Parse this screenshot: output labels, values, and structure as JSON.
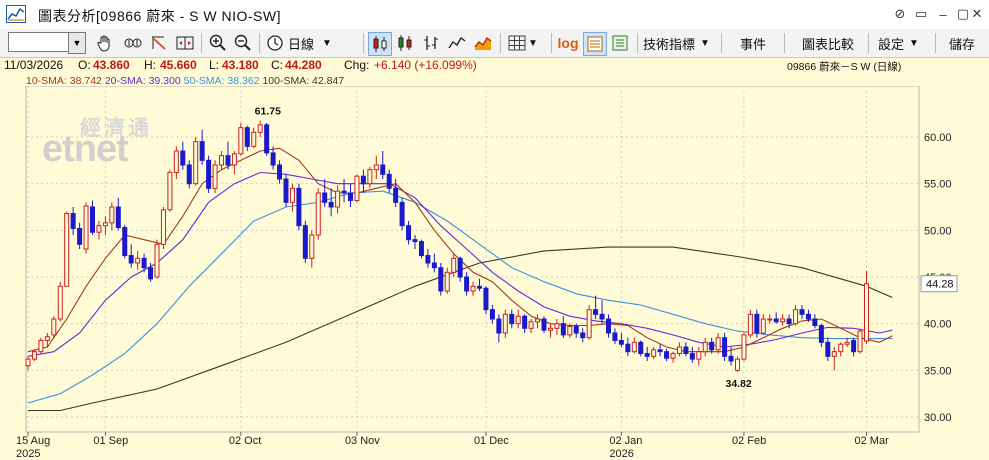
{
  "window": {
    "title": "圖表分析[09866 蔚來 - S W NIO-SW]",
    "buttons": [
      "⊘",
      "▭",
      "–",
      "▢",
      "✕"
    ]
  },
  "toolbar": {
    "code_value": "",
    "interval_label": "日線",
    "indicators_label": "技術指標",
    "events_label": "事件",
    "compare_label": "圖表比較",
    "settings_label": "設定",
    "save_label": "儲存",
    "log_label": "log"
  },
  "info": {
    "date": "11/03/2026",
    "open_label": "O:",
    "open": "43.860",
    "high_label": "H:",
    "high": "45.660",
    "low_label": "L:",
    "low": "43.180",
    "close_label": "C:",
    "close": "44.280",
    "chg_label": "Chg:",
    "chg": "+6.140 (+16.099%)",
    "symbol": "09866 蔚來－S W (日線)"
  },
  "sma": {
    "sma10": "10-SMA: 38.742",
    "sma20": "20-SMA: 39.300",
    "sma50": "50-SMA: 38.362",
    "sma100": "100-SMA: 42.847"
  },
  "watermark": {
    "cn": "經濟通",
    "en": "etnet"
  },
  "colors": {
    "up": "#cc2222",
    "down": "#1a1acc",
    "sma10": "#a03a1a",
    "sma20": "#6a2ad8",
    "sma50": "#3f8fe0",
    "sma100": "#3a3a22",
    "bg": "#fffbd6",
    "grid": "#cfcfcf",
    "last_label_bg": "#ffffff"
  },
  "chart_data": {
    "type": "candlestick",
    "y_axis": {
      "min": 28,
      "max": 63,
      "ticks": [
        "30.00",
        "35.00",
        "40.00",
        "45.00",
        "50.00",
        "55.00",
        "60.00"
      ],
      "last_value": "44.28"
    },
    "x_axis": {
      "labels": [
        {
          "text": "15 Aug",
          "sub": "2025",
          "i": 0
        },
        {
          "text": "01 Sep",
          "sub": "",
          "i": 12
        },
        {
          "text": "02 Oct",
          "sub": "",
          "i": 33
        },
        {
          "text": "03 Nov",
          "sub": "",
          "i": 51
        },
        {
          "text": "01 Dec",
          "sub": "",
          "i": 71
        },
        {
          "text": "02 Jan",
          "sub": "2026",
          "i": 92
        },
        {
          "text": "02 Feb",
          "sub": "",
          "i": 111
        },
        {
          "text": "02 Mar",
          "sub": "",
          "i": 130
        }
      ]
    },
    "annotations": [
      {
        "text": "61.75",
        "i": 37,
        "price": 61.75,
        "pos": "above"
      },
      {
        "text": "34.82",
        "i": 110,
        "price": 34.82,
        "pos": "below"
      }
    ],
    "ohlc": [
      [
        35.5,
        36.5,
        35.0,
        36.2
      ],
      [
        36.2,
        37.2,
        36.0,
        37.0
      ],
      [
        37.0,
        38.5,
        36.8,
        38.2
      ],
      [
        38.2,
        39.0,
        37.5,
        38.6
      ],
      [
        38.8,
        40.8,
        38.5,
        40.5
      ],
      [
        40.5,
        44.5,
        40.2,
        44.0
      ],
      [
        44.0,
        52.0,
        44.0,
        51.8
      ],
      [
        51.8,
        52.5,
        49.5,
        50.2
      ],
      [
        50.2,
        50.8,
        48.0,
        48.5
      ],
      [
        48.0,
        53.0,
        47.5,
        52.6
      ],
      [
        52.5,
        53.2,
        49.5,
        49.8
      ],
      [
        49.8,
        51.0,
        49.0,
        50.5
      ],
      [
        50.5,
        51.5,
        49.5,
        50.8
      ],
      [
        50.8,
        53.0,
        50.0,
        52.5
      ],
      [
        52.5,
        53.5,
        50.0,
        50.3
      ],
      [
        50.3,
        50.6,
        47.0,
        47.3
      ],
      [
        47.3,
        48.5,
        46.0,
        46.5
      ],
      [
        46.5,
        47.8,
        45.8,
        47.0
      ],
      [
        47.0,
        47.5,
        45.5,
        46.0
      ],
      [
        46.0,
        46.5,
        44.5,
        44.8
      ],
      [
        45.0,
        49.0,
        44.8,
        48.5
      ],
      [
        48.5,
        52.5,
        48.0,
        52.2
      ],
      [
        52.2,
        56.5,
        52.0,
        56.2
      ],
      [
        56.2,
        59.0,
        55.5,
        58.5
      ],
      [
        58.5,
        59.5,
        56.5,
        57.0
      ],
      [
        57.0,
        57.5,
        54.5,
        55.0
      ],
      [
        55.0,
        60.0,
        54.8,
        59.5
      ],
      [
        59.5,
        60.8,
        57.0,
        57.5
      ],
      [
        57.5,
        58.0,
        54.0,
        54.5
      ],
      [
        54.5,
        57.5,
        54.0,
        57.0
      ],
      [
        57.0,
        58.5,
        56.5,
        58.0
      ],
      [
        58.0,
        59.5,
        56.5,
        57.0
      ],
      [
        57.0,
        58.5,
        56.0,
        58.2
      ],
      [
        58.2,
        61.5,
        58.0,
        61.0
      ],
      [
        61.0,
        61.2,
        58.5,
        59.0
      ],
      [
        59.0,
        61.0,
        58.8,
        60.5
      ],
      [
        60.5,
        61.75,
        60.0,
        61.3
      ],
      [
        61.3,
        61.5,
        58.0,
        58.3
      ],
      [
        58.3,
        59.0,
        56.5,
        57.0
      ],
      [
        57.0,
        57.5,
        55.0,
        55.5
      ],
      [
        55.5,
        56.0,
        52.5,
        53.0
      ],
      [
        53.0,
        55.0,
        52.0,
        54.5
      ],
      [
        54.5,
        55.0,
        50.0,
        50.5
      ],
      [
        50.5,
        51.0,
        46.5,
        47.0
      ],
      [
        47.0,
        50.0,
        46.0,
        49.5
      ],
      [
        49.5,
        54.5,
        49.0,
        54.0
      ],
      [
        54.0,
        55.5,
        52.5,
        53.0
      ],
      [
        53.0,
        54.5,
        51.5,
        52.5
      ],
      [
        52.5,
        54.8,
        51.8,
        54.2
      ],
      [
        54.2,
        55.5,
        53.0,
        54.0
      ],
      [
        54.0,
        55.0,
        52.5,
        53.2
      ],
      [
        53.2,
        56.0,
        53.0,
        55.8
      ],
      [
        55.8,
        56.5,
        54.0,
        55.0
      ],
      [
        55.0,
        56.8,
        54.5,
        56.5
      ],
      [
        56.5,
        58.0,
        55.5,
        57.0
      ],
      [
        57.0,
        58.5,
        55.5,
        56.0
      ],
      [
        56.0,
        56.5,
        54.0,
        54.5
      ],
      [
        54.5,
        55.5,
        52.5,
        53.0
      ],
      [
        53.0,
        53.5,
        50.0,
        50.5
      ],
      [
        50.5,
        51.0,
        48.5,
        49.0
      ],
      [
        49.0,
        49.5,
        48.0,
        48.8
      ],
      [
        48.8,
        49.0,
        47.0,
        47.3
      ],
      [
        47.3,
        48.0,
        46.0,
        46.5
      ],
      [
        46.5,
        47.5,
        45.5,
        46.0
      ],
      [
        46.0,
        46.5,
        43.0,
        43.5
      ],
      [
        43.5,
        46.0,
        43.2,
        45.5
      ],
      [
        45.5,
        47.5,
        45.0,
        47.0
      ],
      [
        47.0,
        47.2,
        44.5,
        45.0
      ],
      [
        45.0,
        45.5,
        43.0,
        43.5
      ],
      [
        43.5,
        44.5,
        43.0,
        44.0
      ],
      [
        44.0,
        44.8,
        43.5,
        43.8
      ],
      [
        43.8,
        44.0,
        41.0,
        41.5
      ],
      [
        41.5,
        42.0,
        40.0,
        40.5
      ],
      [
        40.5,
        41.0,
        38.0,
        39.0
      ],
      [
        39.0,
        41.5,
        38.5,
        41.0
      ],
      [
        41.0,
        41.5,
        39.5,
        40.0
      ],
      [
        40.0,
        41.5,
        39.5,
        40.8
      ],
      [
        40.8,
        41.0,
        39.0,
        39.5
      ],
      [
        39.5,
        40.5,
        39.0,
        40.2
      ],
      [
        40.2,
        41.0,
        39.5,
        40.5
      ],
      [
        40.5,
        40.8,
        39.0,
        39.3
      ],
      [
        39.3,
        40.0,
        38.5,
        39.5
      ],
      [
        39.5,
        40.5,
        38.8,
        40.0
      ],
      [
        40.0,
        40.8,
        38.5,
        38.8
      ],
      [
        38.8,
        40.0,
        38.5,
        39.7
      ],
      [
        39.7,
        40.0,
        38.5,
        39.0
      ],
      [
        39.0,
        39.5,
        38.0,
        38.5
      ],
      [
        38.5,
        42.0,
        38.3,
        41.5
      ],
      [
        41.5,
        43.0,
        40.5,
        41.0
      ],
      [
        41.0,
        42.5,
        40.0,
        40.5
      ],
      [
        40.5,
        41.0,
        38.5,
        39.0
      ],
      [
        39.0,
        39.5,
        37.8,
        38.2
      ],
      [
        38.2,
        39.0,
        37.5,
        37.8
      ],
      [
        37.8,
        38.5,
        36.5,
        37.0
      ],
      [
        37.0,
        38.5,
        36.8,
        38.0
      ],
      [
        38.0,
        38.2,
        36.5,
        36.8
      ],
      [
        36.8,
        37.5,
        36.0,
        36.5
      ],
      [
        36.5,
        37.5,
        36.2,
        37.2
      ],
      [
        37.2,
        37.8,
        36.5,
        37.0
      ],
      [
        37.0,
        37.3,
        36.0,
        36.3
      ],
      [
        36.3,
        37.0,
        35.8,
        36.8
      ],
      [
        36.8,
        38.0,
        36.5,
        37.5
      ],
      [
        37.5,
        38.0,
        36.5,
        36.8
      ],
      [
        36.8,
        37.5,
        35.8,
        36.2
      ],
      [
        36.2,
        37.5,
        35.5,
        37.0
      ],
      [
        37.0,
        38.5,
        36.5,
        38.0
      ],
      [
        38.0,
        38.5,
        36.8,
        37.2
      ],
      [
        37.2,
        39.0,
        36.8,
        38.5
      ],
      [
        38.5,
        39.0,
        36.0,
        36.5
      ],
      [
        36.5,
        37.5,
        35.5,
        36.0
      ],
      [
        35.0,
        36.5,
        34.82,
        36.2
      ],
      [
        36.2,
        39.0,
        36.0,
        38.8
      ],
      [
        38.8,
        41.5,
        38.5,
        41.0
      ],
      [
        41.0,
        41.5,
        38.5,
        39.0
      ],
      [
        39.0,
        41.0,
        38.8,
        40.5
      ],
      [
        40.5,
        41.0,
        40.0,
        40.5
      ],
      [
        40.5,
        41.2,
        40.0,
        40.2
      ],
      [
        40.2,
        41.0,
        39.8,
        40.5
      ],
      [
        40.5,
        41.0,
        39.5,
        40.0
      ],
      [
        40.0,
        42.0,
        39.8,
        41.5
      ],
      [
        41.5,
        42.0,
        40.5,
        41.0
      ],
      [
        41.0,
        41.5,
        40.2,
        40.5
      ],
      [
        40.5,
        41.0,
        39.5,
        39.8
      ],
      [
        39.8,
        40.0,
        37.5,
        38.0
      ],
      [
        38.0,
        38.5,
        36.0,
        36.5
      ],
      [
        36.5,
        37.5,
        35.0,
        37.0
      ],
      [
        37.0,
        38.0,
        36.5,
        37.8
      ],
      [
        37.8,
        38.5,
        37.5,
        38.0
      ],
      [
        38.2,
        38.5,
        36.5,
        37.0
      ],
      [
        37.0,
        39.5,
        36.8,
        39.2
      ],
      [
        38.14,
        45.66,
        37.8,
        44.28
      ]
    ],
    "sma10": [
      [
        0,
        37.0
      ],
      [
        3,
        37.5
      ],
      [
        6,
        40.5
      ],
      [
        9,
        44.0
      ],
      [
        12,
        47.0
      ],
      [
        15,
        49.5
      ],
      [
        18,
        49.0
      ],
      [
        21,
        48.5
      ],
      [
        24,
        51.5
      ],
      [
        27,
        55.0
      ],
      [
        30,
        56.5
      ],
      [
        33,
        57.5
      ],
      [
        36,
        58.5
      ],
      [
        39,
        58.8
      ],
      [
        42,
        57.5
      ],
      [
        45,
        55.0
      ],
      [
        48,
        54.0
      ],
      [
        51,
        54.0
      ],
      [
        54,
        54.5
      ],
      [
        57,
        55.0
      ],
      [
        60,
        53.0
      ],
      [
        63,
        50.0
      ],
      [
        66,
        47.5
      ],
      [
        69,
        45.5
      ],
      [
        72,
        44.5
      ],
      [
        75,
        42.5
      ],
      [
        78,
        40.8
      ],
      [
        81,
        40.0
      ],
      [
        84,
        39.8
      ],
      [
        87,
        39.8
      ],
      [
        90,
        40.0
      ],
      [
        93,
        39.8
      ],
      [
        96,
        38.5
      ],
      [
        99,
        37.5
      ],
      [
        102,
        37.0
      ],
      [
        105,
        37.0
      ],
      [
        108,
        37.0
      ],
      [
        111,
        37.5
      ],
      [
        114,
        38.5
      ],
      [
        117,
        39.5
      ],
      [
        120,
        40.3
      ],
      [
        123,
        40.5
      ],
      [
        126,
        39.5
      ],
      [
        129,
        38.5
      ],
      [
        132,
        38.0
      ],
      [
        134,
        38.7
      ]
    ],
    "sma20": [
      [
        0,
        36.5
      ],
      [
        4,
        37.0
      ],
      [
        8,
        39.0
      ],
      [
        12,
        42.5
      ],
      [
        16,
        45.0
      ],
      [
        20,
        46.5
      ],
      [
        24,
        49.0
      ],
      [
        28,
        53.0
      ],
      [
        32,
        55.0
      ],
      [
        36,
        56.2
      ],
      [
        40,
        56.0
      ],
      [
        44,
        55.5
      ],
      [
        48,
        55.0
      ],
      [
        52,
        55.0
      ],
      [
        56,
        55.0
      ],
      [
        60,
        53.5
      ],
      [
        64,
        50.5
      ],
      [
        68,
        48.0
      ],
      [
        72,
        45.5
      ],
      [
        76,
        43.5
      ],
      [
        80,
        41.8
      ],
      [
        84,
        40.8
      ],
      [
        88,
        40.3
      ],
      [
        92,
        40.0
      ],
      [
        96,
        39.5
      ],
      [
        100,
        38.8
      ],
      [
        104,
        38.0
      ],
      [
        108,
        37.5
      ],
      [
        112,
        37.8
      ],
      [
        116,
        38.3
      ],
      [
        120,
        39.0
      ],
      [
        124,
        39.6
      ],
      [
        128,
        39.5
      ],
      [
        132,
        39.0
      ],
      [
        134,
        39.3
      ]
    ],
    "sma50": [
      [
        0,
        31.5
      ],
      [
        5,
        32.5
      ],
      [
        10,
        34.5
      ],
      [
        15,
        36.8
      ],
      [
        20,
        40.0
      ],
      [
        25,
        44.0
      ],
      [
        30,
        47.5
      ],
      [
        35,
        51.0
      ],
      [
        40,
        52.5
      ],
      [
        45,
        53.0
      ],
      [
        50,
        54.0
      ],
      [
        55,
        54.2
      ],
      [
        60,
        53.0
      ],
      [
        65,
        51.0
      ],
      [
        70,
        48.5
      ],
      [
        75,
        46.0
      ],
      [
        80,
        44.5
      ],
      [
        85,
        43.2
      ],
      [
        90,
        42.5
      ],
      [
        95,
        42.0
      ],
      [
        100,
        41.0
      ],
      [
        105,
        40.0
      ],
      [
        110,
        39.2
      ],
      [
        115,
        38.8
      ],
      [
        120,
        38.5
      ],
      [
        125,
        38.4
      ],
      [
        130,
        38.4
      ],
      [
        134,
        38.4
      ]
    ],
    "sma100": [
      [
        0,
        30.7
      ],
      [
        5,
        30.7
      ],
      [
        10,
        31.5
      ],
      [
        20,
        33.0
      ],
      [
        30,
        35.5
      ],
      [
        40,
        38.0
      ],
      [
        50,
        41.0
      ],
      [
        60,
        44.0
      ],
      [
        70,
        46.5
      ],
      [
        80,
        47.8
      ],
      [
        90,
        48.2
      ],
      [
        100,
        48.2
      ],
      [
        110,
        47.2
      ],
      [
        120,
        46.0
      ],
      [
        130,
        44.0
      ],
      [
        134,
        42.8
      ]
    ]
  }
}
